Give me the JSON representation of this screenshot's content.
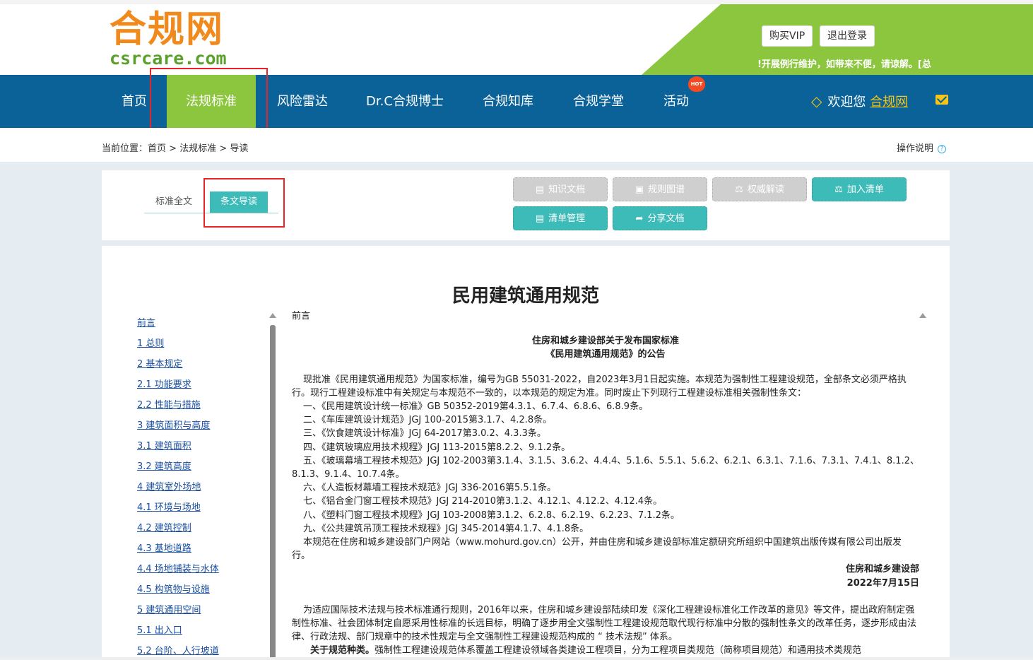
{
  "logo": {
    "cn": "合规网",
    "en": "csrcare.com"
  },
  "header": {
    "buy_vip": "购买VIP",
    "logout": "退出登录",
    "notice": "!开展例行维护，如带来不便，请谅解。[总"
  },
  "nav": {
    "items": [
      {
        "label": "首页"
      },
      {
        "label": "法规标准"
      },
      {
        "label": "风险雷达"
      },
      {
        "label": "Dr.C合规博士"
      },
      {
        "label": "合规知库"
      },
      {
        "label": "合规学堂"
      },
      {
        "label": "活动"
      }
    ],
    "hot_badge": "HOT",
    "welcome": "欢迎您",
    "username": "合规网",
    "colors": {
      "nav_bg": "#0a6298",
      "active_bg": "#8cc63f",
      "accent": "#3dbbb8"
    }
  },
  "breadcrumb": {
    "prefix": "当前位置：",
    "home": "首页",
    "sep": ">",
    "section": "法规标准",
    "current": "导读"
  },
  "help": "操作说明",
  "tabs": {
    "full": "标准全文",
    "guide": "条文导读"
  },
  "toolbar": {
    "knowledge": "知识文档",
    "rule_map": "规则图谱",
    "interpretation": "权威解读",
    "add_list": "加入清单",
    "manage_list": "清单管理",
    "share": "分享文档"
  },
  "document": {
    "title": "民用建筑通用规范",
    "section_label": "前言",
    "notice_title_1": "住房和城乡建设部关于发布国家标准",
    "notice_title_2": "《民用建筑通用规范》的公告",
    "para1": "现批准《民用建筑通用规范》为国家标准，编号为GB 55031-2022，自2023年3月1日起实施。本规范为强制性工程建设规范，全部条文必须严格执行。现行工程建设标准中有关规定与本规范不一致的，以本规范的规定为准。同时废止下列现行工程建设标准相关强制性条文：",
    "items": [
      "一、《民用建筑设计统一标准》GB 50352-2019第4.3.1、6.7.4、6.8.6、6.8.9条。",
      "二、《车库建筑设计规范》JGJ 100-2015第3.1.7、4.2.8条。",
      "三、《饮食建筑设计标准》JGJ 64-2017第3.0.2、4.3.3条。",
      "四、《建筑玻璃应用技术规程》JGJ 113-2015第8.2.2、9.1.2条。",
      "五、《玻璃幕墙工程技术规范》JGJ 102-2003第3.1.4、3.1.5、3.6.2、4.4.4、5.1.6、5.5.1、5.6.2、6.2.1、6.3.1、7.1.6、7.3.1、7.4.1、8.1.2、8.1.3、9.1.4、10.7.4条。",
      "六、《人造板材幕墙工程技术规范》JGJ 336-2016第5.5.1条。",
      "七、《铝合金门窗工程技术规范》JGJ 214-2010第3.1.2、4.12.1、4.12.2、4.12.4条。",
      "八、《塑料门窗工程技术规程》JGJ 103-2008第3.1.2、6.2.8、6.2.19、6.2.23、7.1.2条。",
      "九、《公共建筑吊顶工程技术规程》JGJ 345-2014第4.1.7、4.1.8条。"
    ],
    "publish": "本规范在住房和城乡建设部门户网站（www.mohurd.gov.cn）公开，并由住房和城乡建设部标准定额研究所组织中国建筑出版传媒有限公司出版发行。",
    "signer": "住房和城乡建设部",
    "date": "2022年7月15日",
    "para2": "为适应国际技术法规与技术标准通行规则，2016年以来，住房和城乡建设部陆续印发《深化工程建设标准化工作改革的意见》等文件，提出政府制定强制性标准、社会团体制定自愿采用性标准的长远目标，明确了逐步用全文强制性工程建设规范取代现行标准中分散的强制性条文的改革任务，逐步形成由法律、行政法规、部门规章中的技术性规定与全文强制性工程建设规范构成的 “ 技术法规” 体系。",
    "para3_bold": "关于规范种类。",
    "para3": "强制性工程建设规范体系覆盖工程建设领域各类建设工程项目，分为工程项目类规范（简称项目规范）和通用技术类规范"
  },
  "toc": [
    "前言",
    "1 总则",
    "2 基本规定",
    "2.1 功能要求",
    "2.2 性能与措施",
    "3 建筑面积与高度",
    "3.1 建筑面积",
    "3.2 建筑高度",
    "4 建筑室外场地",
    "4.1 环境与场地",
    "4.2 建筑控制",
    "4.3 基地道路",
    "4.4 场地铺装与水体",
    "4.5 构筑物与设施",
    "5 建筑通用空间",
    "5.1 出入口",
    "5.2 台阶、人行坡道"
  ]
}
